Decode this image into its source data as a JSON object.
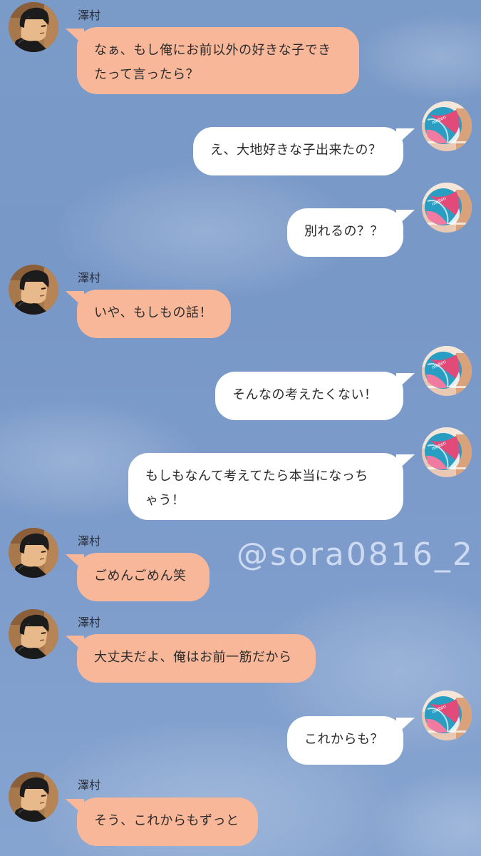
{
  "colors": {
    "background": "#7a9ac8",
    "incoming_bubble": "#f9b79a",
    "outgoing_bubble": "#ffffff"
  },
  "contact": {
    "name": "澤村",
    "avatar_icon": "character-avatar-icon"
  },
  "self": {
    "avatar_icon": "volleyball-avatar-icon"
  },
  "watermark": "@sora0816_2",
  "messages": [
    {
      "from": "contact",
      "name": "澤村",
      "text": "なぁ、もし俺にお前以外の好きな子でき\nたって言ったら？"
    },
    {
      "from": "self",
      "text": "え、大地好きな子出来たの？"
    },
    {
      "from": "self",
      "text": "別れるの？？"
    },
    {
      "from": "contact",
      "name": "澤村",
      "text": "いや、もしもの話！"
    },
    {
      "from": "self",
      "text": "そんなの考えたくない！"
    },
    {
      "from": "self",
      "text": "もしもなんて考えてたら本当になっち\nゃう！"
    },
    {
      "from": "contact",
      "name": "澤村",
      "text": "ごめんごめん笑"
    },
    {
      "from": "contact",
      "name": "澤村",
      "text": "大丈夫だよ、俺はお前一筋だから"
    },
    {
      "from": "self",
      "text": "これからも？"
    },
    {
      "from": "contact",
      "name": "澤村",
      "text": "そう、これからもずっと"
    }
  ]
}
